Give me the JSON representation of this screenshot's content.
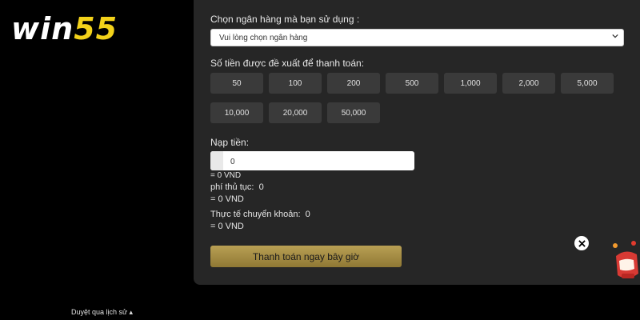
{
  "logo": {
    "part1": "win",
    "part2": "55"
  },
  "bank": {
    "label": "Chọn ngân hàng mà bạn sử dụng :",
    "placeholder": "Vui lòng chọn ngân hàng"
  },
  "suggest": {
    "label": "Số tiền được đề xuất để thanh toán:",
    "amounts": [
      "50",
      "100",
      "200",
      "500",
      "1,000",
      "2,000",
      "5,000",
      "10,000",
      "20,000",
      "50,000"
    ]
  },
  "deposit": {
    "label": "Nạp tiền:",
    "value": "0",
    "converted": "= 0 VND"
  },
  "fee": {
    "label": "phí thủ tục:",
    "value": "0",
    "converted": "= 0 VND"
  },
  "actual": {
    "label": "Thực tế chuyển khoản:",
    "value": "0",
    "converted": "= 0 VND"
  },
  "pay_button": "Thanh toán ngay bây giờ",
  "history_link": "Duyệt qua lịch sử ▴",
  "icons": {
    "close": "close-icon",
    "promo": "gift-icon",
    "chevron": "chevron-down-icon"
  },
  "colors": {
    "logo_accent": "#f3d21a",
    "button_gold": "#b9a054",
    "panel_bg": "#262626"
  }
}
